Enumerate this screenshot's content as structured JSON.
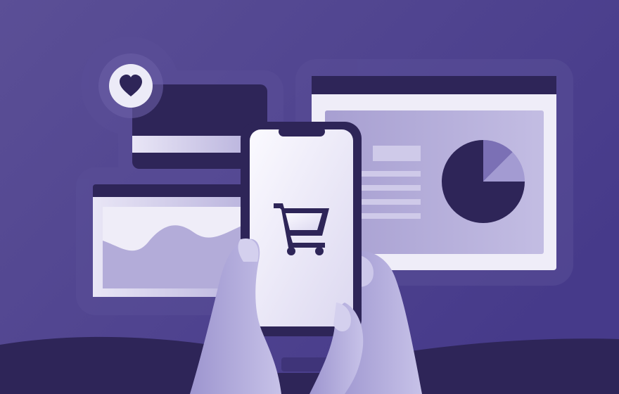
{
  "illustration": {
    "theme": "mobile-shopping-analytics",
    "colors": {
      "background_start": "#5b4f96",
      "background_end": "#463a8a",
      "dark": "#2e2558",
      "light": "#efedf8",
      "muted": "#b7b1db",
      "accent": "#7b70b5"
    },
    "icons": {
      "heart": "heart-icon",
      "cart": "shopping-cart-icon",
      "pie": "pie-chart-icon"
    },
    "pie_chart": {
      "slices": [
        0.75,
        0.125,
        0.125
      ]
    }
  }
}
